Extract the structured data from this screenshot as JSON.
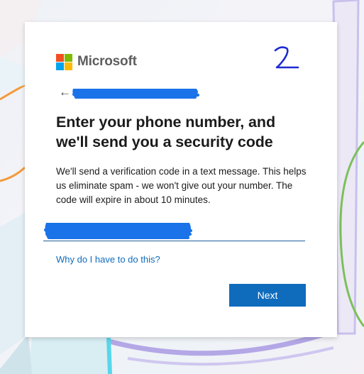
{
  "brand": {
    "name": "Microsoft",
    "logo_colors": [
      "#f25022",
      "#7fba00",
      "#00a4ef",
      "#ffb900"
    ]
  },
  "annotation": {
    "handwritten_mark": "2"
  },
  "back": {
    "icon": "back-arrow-icon",
    "glyph": "←"
  },
  "title": "Enter your phone number, and we'll send you a security code",
  "description": "We'll send a verification code in a text message. This helps us eliminate spam - we won't give out your number. The code will expire in about 10 minutes.",
  "phone_input": {
    "value": ""
  },
  "link": {
    "label": "Why do I have to do this?"
  },
  "buttons": {
    "next_label": "Next"
  },
  "colors": {
    "accent": "#0f6cbd",
    "redaction": "#1a73e8"
  }
}
